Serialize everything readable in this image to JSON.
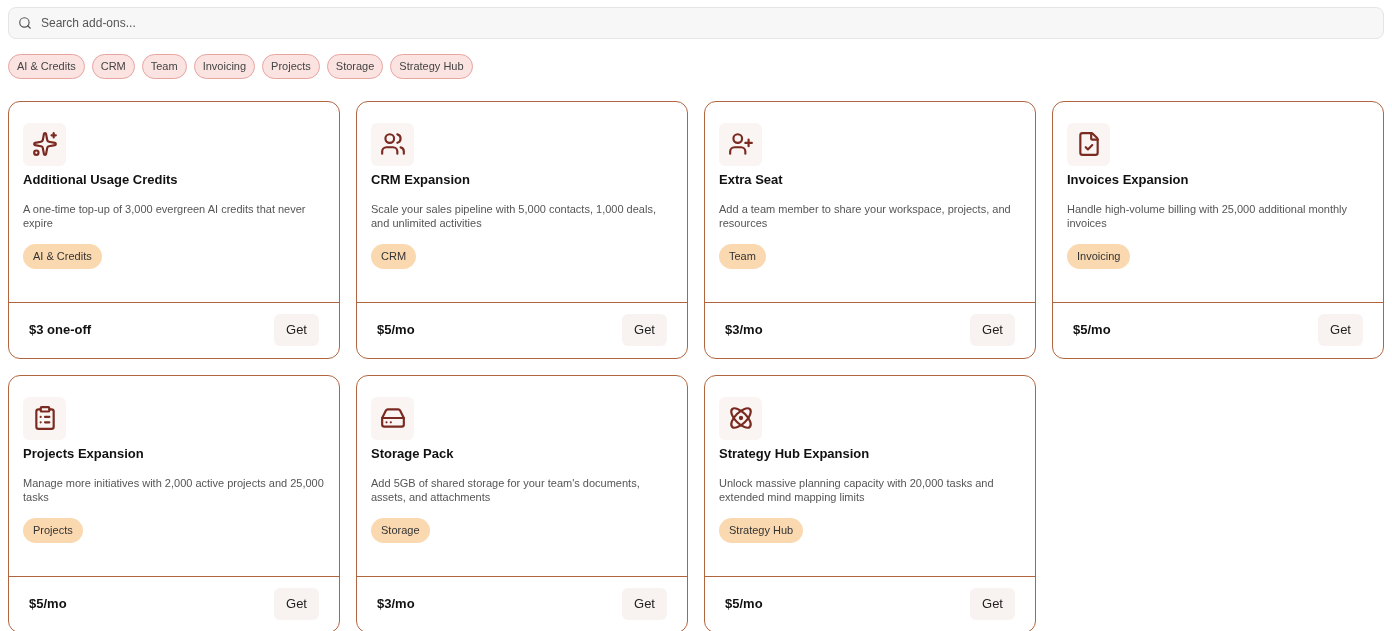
{
  "search": {
    "placeholder": "Search add-ons..."
  },
  "filters": [
    "AI & Credits",
    "CRM",
    "Team",
    "Invoicing",
    "Projects",
    "Storage",
    "Strategy Hub"
  ],
  "addons": [
    {
      "kind": "sparkles",
      "title": "Additional Usage Credits",
      "description": "A one-time top-up of 3,000 evergreen AI credits that never expire",
      "tag": "AI & Credits",
      "price": "$3 one-off",
      "action": "Get"
    },
    {
      "kind": "users",
      "title": "CRM Expansion",
      "description": "Scale your sales pipeline with 5,000 contacts, 1,000 deals, and unlimited activities",
      "tag": "CRM",
      "price": "$5/mo",
      "action": "Get"
    },
    {
      "kind": "seat",
      "title": "Extra Seat",
      "description": "Add a team member to share your workspace, projects, and resources",
      "tag": "Team",
      "price": "$3/mo",
      "action": "Get"
    },
    {
      "kind": "invoices",
      "title": "Invoices Expansion",
      "description": "Handle high-volume billing with 25,000 additional monthly invoices",
      "tag": "Invoicing",
      "price": "$5/mo",
      "action": "Get"
    },
    {
      "kind": "projects",
      "title": "Projects Expansion",
      "description": "Manage more initiatives with 2,000 active projects and 25,000 tasks",
      "tag": "Projects",
      "price": "$5/mo",
      "action": "Get"
    },
    {
      "kind": "storage",
      "title": "Storage Pack",
      "description": "Add 5GB of shared storage for your team's documents, assets, and attachments",
      "tag": "Storage",
      "price": "$3/mo",
      "action": "Get"
    },
    {
      "kind": "strategy",
      "title": "Strategy Hub Expansion",
      "description": "Unlock massive planning capacity with 20,000 tasks and extended mind mapping limits",
      "tag": "Strategy Hub",
      "price": "$5/mo",
      "action": "Get"
    }
  ]
}
